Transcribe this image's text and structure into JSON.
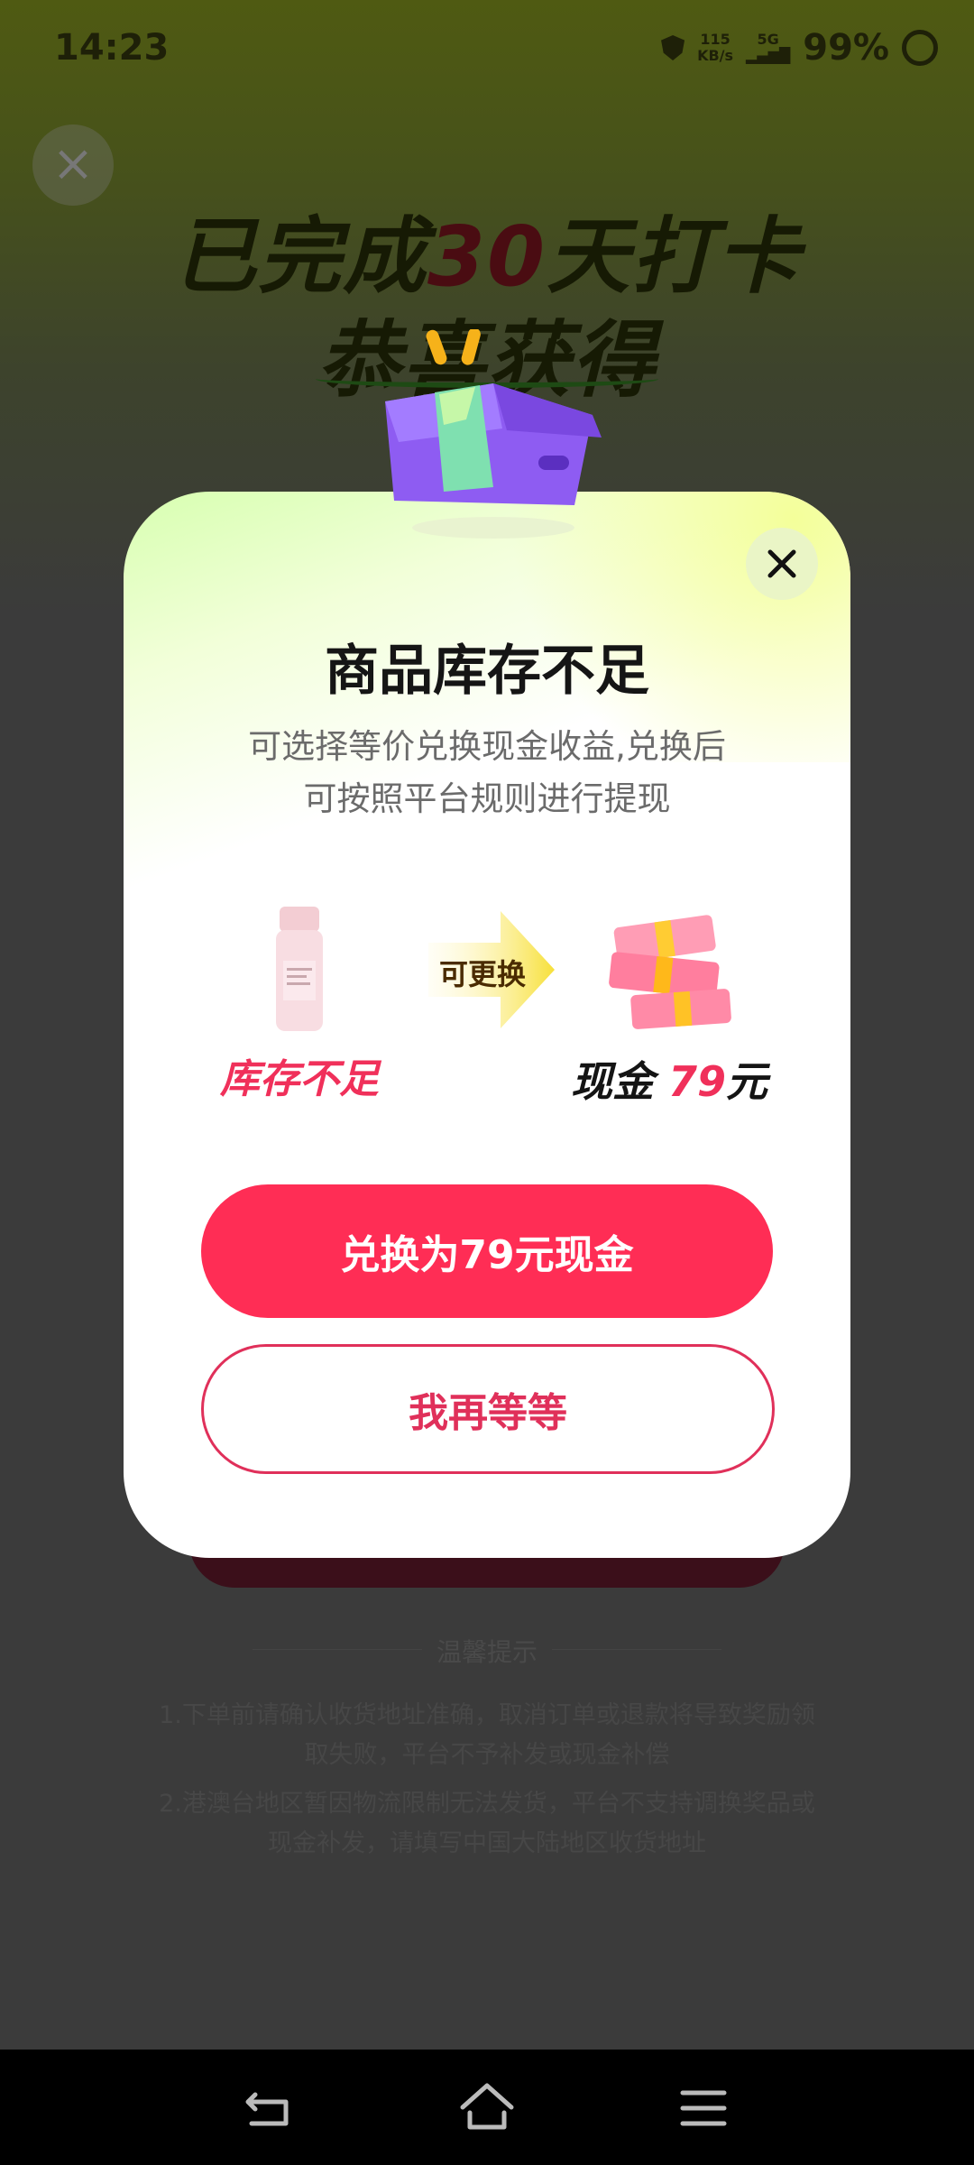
{
  "status_bar": {
    "time": "14:23",
    "net_speed_value": "115",
    "net_speed_unit": "KB/s",
    "network": "5G",
    "battery": "99%"
  },
  "background": {
    "title_part1": "已完成",
    "title_days": "30",
    "title_part2": "天打卡",
    "subtitle": "恭喜获得",
    "tips_title": "温馨提示",
    "tips": [
      "1.下单前请确认收货地址准确，取消订单或退款将导致奖励领取失败，平台不予补发或现金补偿",
      "2.港澳台地区暂因物流限制无法发货，平台不支持调换奖品或现金补发，请填写中国大陆地区收货地址"
    ]
  },
  "modal": {
    "title": "商品库存不足",
    "desc_line1": "可选择等价兑换现金收益,兑换后",
    "desc_line2": "可按照平台规则进行提现",
    "stock_label": "库存不足",
    "arrow_label": "可更换",
    "cash_prefix": "现金",
    "cash_amount": "79",
    "cash_unit": "元",
    "primary_button": "兑换为79元现金",
    "secondary_button": "我再等等"
  },
  "colors": {
    "accent": "#ff2d55",
    "modal_top": "#d7ffb0",
    "overlay": "#3b3b3b"
  },
  "icons": {
    "close": "close-icon",
    "box": "gift-box-icon",
    "product": "lotion-bottle-icon",
    "arrow": "arrow-right-icon",
    "cash": "cash-stack-icon",
    "back": "back-icon",
    "home": "home-icon",
    "menu": "menu-icon"
  }
}
